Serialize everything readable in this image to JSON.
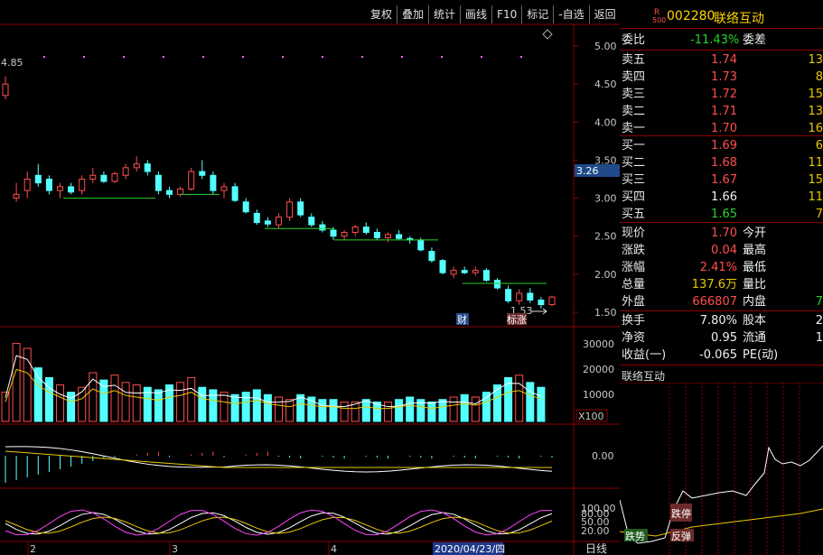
{
  "toolbar": {
    "items": [
      "复权",
      "叠加",
      "统计",
      "画线",
      "F10",
      "标记",
      "-自选",
      "返回"
    ]
  },
  "stock": {
    "r_badge": "R",
    "r_sub": "500",
    "code": "002280",
    "name": "联络互动"
  },
  "main_chart": {
    "y_ticks": [
      "5.00",
      "4.50",
      "4.00",
      "3.50",
      "3.00",
      "2.50",
      "2.00",
      "1.50"
    ],
    "current_price_tag": "3.26",
    "high_label": "4.85",
    "low_label": "1.53",
    "marker_cai": "财",
    "marker_biaozhang": "标涨"
  },
  "volume_chart": {
    "y_ticks": [
      "30000",
      "20000",
      "10000"
    ],
    "unit": "X100"
  },
  "macd_chart": {
    "zero_label": "0.00"
  },
  "kdj_chart": {
    "y_ticks": [
      "100.00",
      "80.00",
      "50.00",
      "20.00"
    ]
  },
  "x_axis": {
    "labels": [
      "2",
      "3",
      "4"
    ],
    "cursor_date": "2020/04/23/四",
    "period": "日线"
  },
  "quote": {
    "weibi_label": "委比",
    "weibi_value": "-11.43%",
    "weicha_label": "委差",
    "sell": [
      {
        "label": "卖五",
        "price": "1.74",
        "vol": "13"
      },
      {
        "label": "卖四",
        "price": "1.73",
        "vol": "8"
      },
      {
        "label": "卖三",
        "price": "1.72",
        "vol": "15"
      },
      {
        "label": "卖二",
        "price": "1.71",
        "vol": "13"
      },
      {
        "label": "卖一",
        "price": "1.70",
        "vol": "16"
      }
    ],
    "buy": [
      {
        "label": "买一",
        "price": "1.69",
        "vol": "6"
      },
      {
        "label": "买二",
        "price": "1.68",
        "vol": "11"
      },
      {
        "label": "买三",
        "price": "1.67",
        "vol": "15"
      },
      {
        "label": "买四",
        "price": "1.66",
        "vol": "11"
      },
      {
        "label": "买五",
        "price": "1.65",
        "vol": "7"
      }
    ],
    "stats": [
      {
        "label": "现价",
        "value": "1.70",
        "label2": "今开"
      },
      {
        "label": "涨跌",
        "value": "0.04",
        "label2": "最高"
      },
      {
        "label": "涨幅",
        "value": "2.41%",
        "label2": "最低"
      },
      {
        "label": "总量",
        "value": "137.6万",
        "label2": "量比"
      },
      {
        "label": "外盘",
        "value": "666807",
        "label2": "内盘",
        "value2": "7"
      }
    ],
    "stats2": [
      {
        "label": "换手",
        "value": "7.80%",
        "label2": "股本",
        "value2": "2"
      },
      {
        "label": "净资",
        "value": "0.95",
        "label2": "流通",
        "value2": "1"
      },
      {
        "label": "收益(一)",
        "value": "-0.065",
        "label2": "PE(动)",
        "value2": ""
      }
    ]
  },
  "mini_chart": {
    "title": "联络互动",
    "tag1": "跌停",
    "tag2": "反弹",
    "tag3": "跌势"
  },
  "colors": {
    "up": "#ff4d4d",
    "down": "#54ffff",
    "ma_green": "#2ad22a",
    "grid_red": "#8b0000"
  }
}
